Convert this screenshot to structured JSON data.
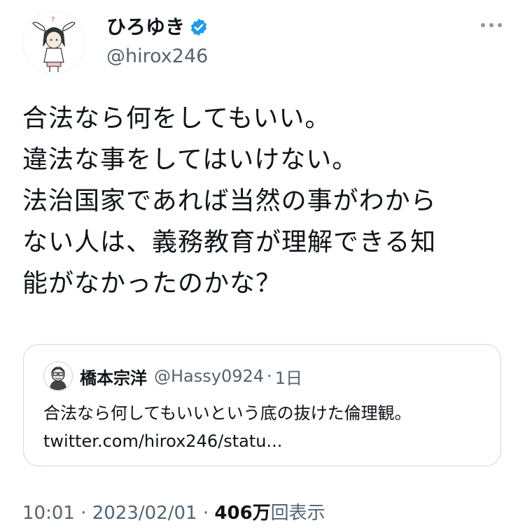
{
  "author": {
    "display_name": "ひろゆき",
    "handle": "@hirox246",
    "verified": true,
    "verified_color": "#1d9bf0"
  },
  "tweet": {
    "lines": [
      "合法なら何をしてもいい。",
      "違法な事をしてはいけない。",
      "法治国家であれば当然の事がわから",
      "ない人は、義務教育が理解できる知",
      "能がなかったのかな？"
    ]
  },
  "quote": {
    "display_name": "橋本宗洋",
    "handle": "@Hassy0924",
    "separator": "·",
    "time": "1日",
    "text_line1": "合法なら何してもいいという底の抜けた倫理観。",
    "text_line2": "twitter.com/hirox246/statu..."
  },
  "meta": {
    "time": "10:01",
    "separator1": " · ",
    "date": "2023/02/01",
    "separator2": " · ",
    "views_count": "406万",
    "views_label": "回表示"
  },
  "icons": {
    "more": "more-icon",
    "verified": "verified-badge-icon",
    "avatar": "avatar-illustration",
    "quote_avatar": "quote-avatar-illustration"
  },
  "colors": {
    "text": "#0f1419",
    "secondary": "#536471",
    "border": "#cfd9de",
    "verified": "#1d9bf0"
  }
}
